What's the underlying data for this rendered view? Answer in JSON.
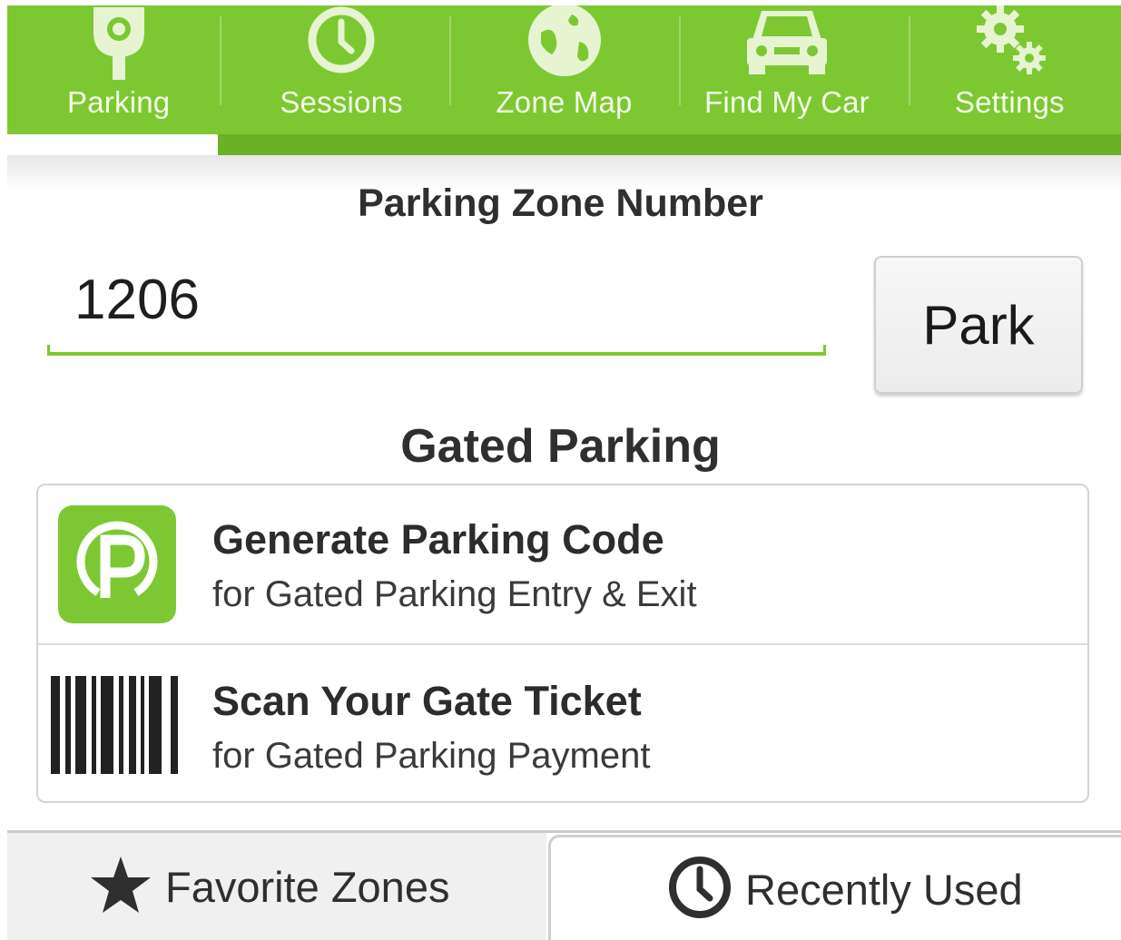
{
  "nav": {
    "tabs": [
      {
        "label": "Parking",
        "icon": "parking-meter-icon",
        "active": true
      },
      {
        "label": "Sessions",
        "icon": "clock-icon"
      },
      {
        "label": "Zone Map",
        "icon": "globe-icon"
      },
      {
        "label": "Find My Car",
        "icon": "car-icon"
      },
      {
        "label": "Settings",
        "icon": "gears-icon"
      }
    ]
  },
  "zone": {
    "title": "Parking Zone Number",
    "value": "1206",
    "park_label": "Park"
  },
  "gated": {
    "title": "Gated Parking",
    "items": [
      {
        "title": "Generate Parking Code",
        "subtitle": "for Gated Parking Entry & Exit",
        "icon": "parking-p-icon"
      },
      {
        "title": "Scan Your Gate Ticket",
        "subtitle": "for Gated Parking Payment",
        "icon": "barcode-icon"
      }
    ]
  },
  "bottom_tabs": {
    "favorites": {
      "label": "Favorite Zones",
      "icon": "star-icon"
    },
    "recent": {
      "label": "Recently Used",
      "icon": "clock-icon",
      "active": true
    }
  },
  "colors": {
    "brand_green": "#7dc832",
    "nav_strip": "#6cb025"
  }
}
